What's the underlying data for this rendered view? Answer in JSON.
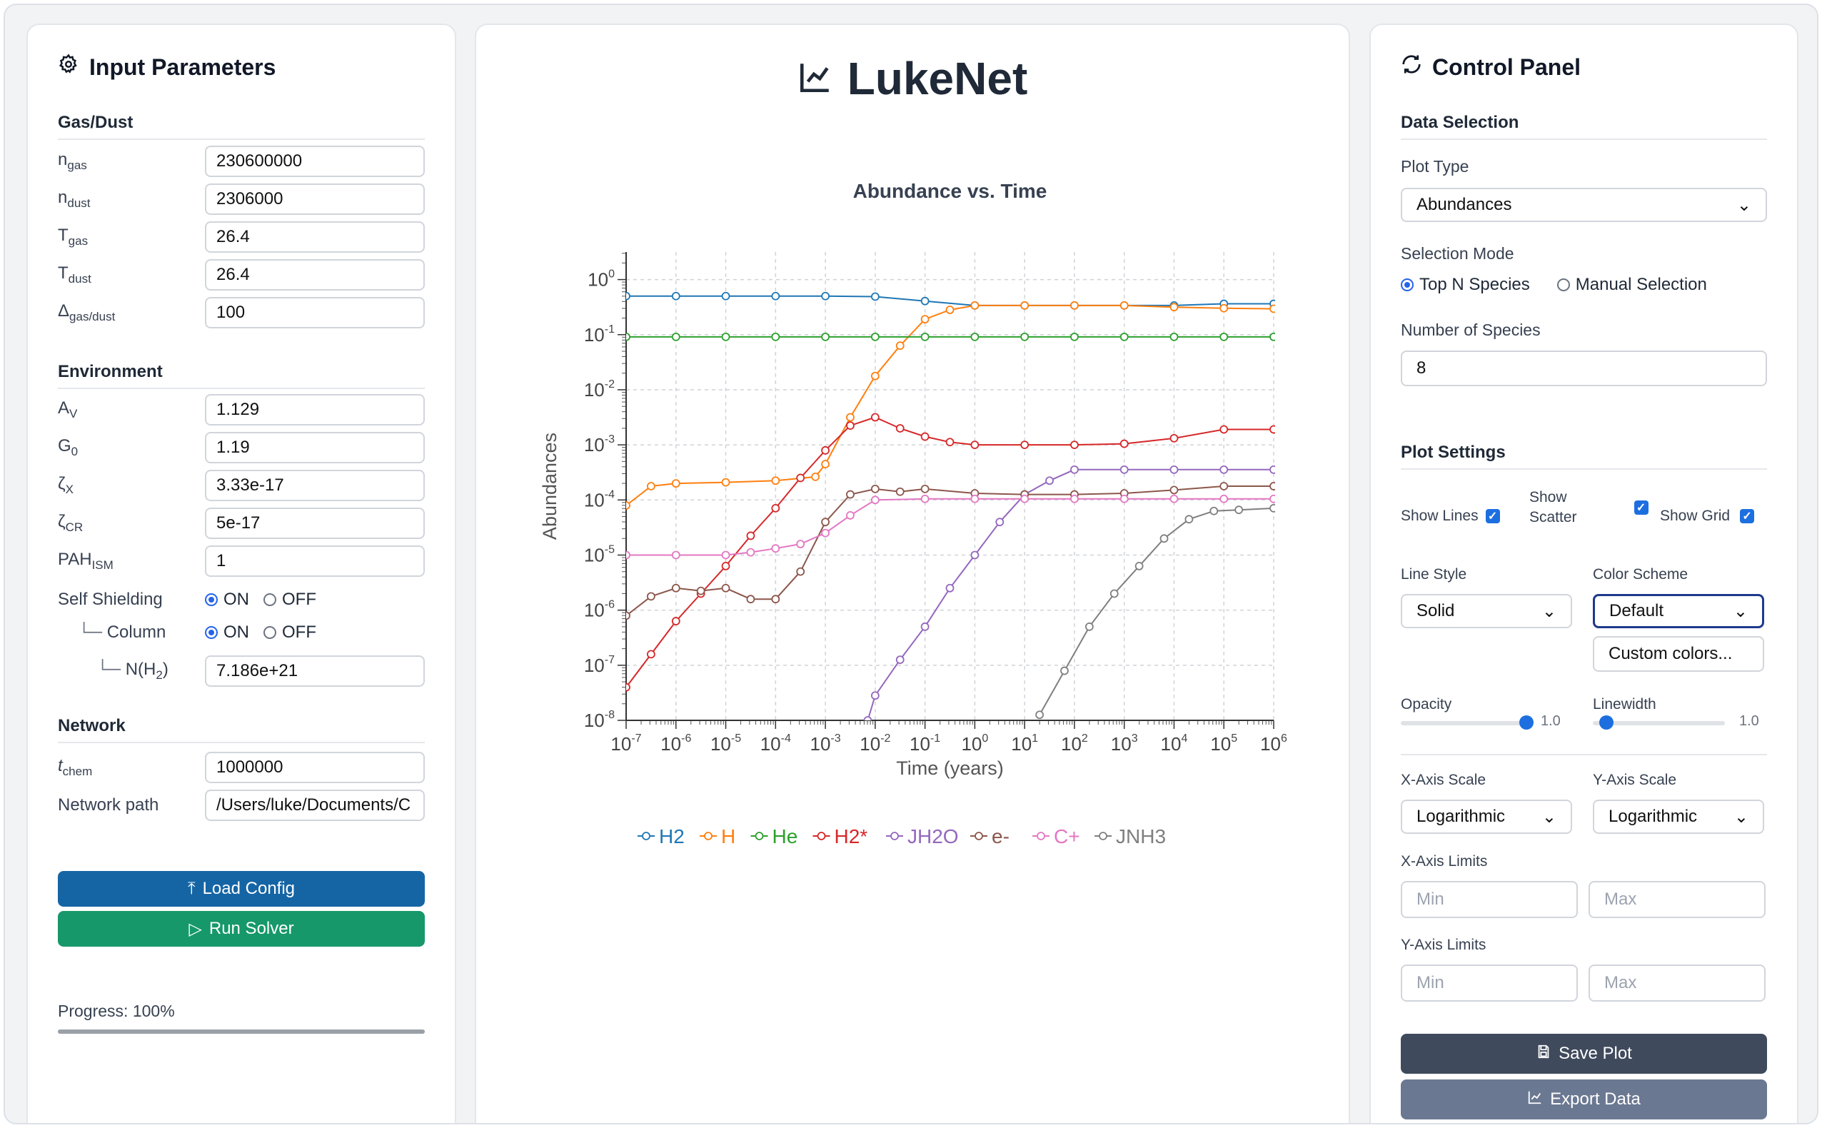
{
  "left": {
    "title": "Input Parameters",
    "gas_dust": {
      "heading": "Gas/Dust",
      "fields": [
        {
          "label": "n",
          "sub": "gas",
          "value": "230600000"
        },
        {
          "label": "n",
          "sub": "dust",
          "value": "2306000"
        },
        {
          "label": "T",
          "sub": "gas",
          "value": "26.4"
        },
        {
          "label": "T",
          "sub": "dust",
          "value": "26.4"
        },
        {
          "label": "Δ",
          "sub": "gas/dust",
          "value": "100"
        }
      ]
    },
    "environment": {
      "heading": "Environment",
      "fields": [
        {
          "label": "A",
          "sub": "V",
          "value": "1.129"
        },
        {
          "label": "G",
          "sub": "0",
          "value": "1.19"
        },
        {
          "label": "ζ",
          "sub": "X",
          "value": "3.33e-17"
        },
        {
          "label": "ζ",
          "sub": "CR",
          "value": "5e-17"
        },
        {
          "label": "PAH",
          "sub": "ISM",
          "value": "1"
        }
      ],
      "self_shielding": {
        "label": "Self Shielding",
        "on": "ON",
        "off": "OFF",
        "selected": "ON"
      },
      "column": {
        "label": "Column",
        "on": "ON",
        "off": "OFF",
        "selected": "ON"
      },
      "nh2": {
        "label": "N(H",
        "sub": "2",
        "label_end": ")",
        "value": "7.186e+21"
      }
    },
    "network": {
      "heading": "Network",
      "tchem": {
        "label": "t",
        "sub": "chem",
        "value": "1000000"
      },
      "path": {
        "label": "Network path",
        "value": "/Users/luke/Documents/C"
      }
    },
    "load_label": "Load Config",
    "run_label": "Run Solver",
    "progress_text": "Progress: 100%",
    "progress": 1.0
  },
  "center": {
    "title": "LukeNet"
  },
  "chart_data": {
    "type": "line",
    "title": "Abundance vs. Time",
    "xlabel": "Time (years)",
    "ylabel": "Abundances",
    "xscale": "log",
    "yscale": "log",
    "xlim": [
      1e-07,
      1000000.0
    ],
    "ylim": [
      1e-08,
      2
    ],
    "grid": true,
    "legend_position": "bottom",
    "x_tick_labels": [
      "10-7",
      "10-6",
      "10-5",
      "10-4",
      "10-3",
      "10-2",
      "10-1",
      "100",
      "101",
      "102",
      "103",
      "104",
      "105",
      "106"
    ],
    "y_tick_labels": [
      "10-8",
      "10-7",
      "10-6",
      "10-5",
      "10-4",
      "10-3",
      "10-2",
      "10-1",
      "100"
    ],
    "series": [
      {
        "name": "H2",
        "color": "#1f77b4",
        "points": [
          [
            -7,
            -0.3
          ],
          [
            -6,
            -0.3
          ],
          [
            -5,
            -0.3
          ],
          [
            -4,
            -0.3
          ],
          [
            -3,
            -0.3
          ],
          [
            -2,
            -0.31
          ],
          [
            -1,
            -0.39
          ],
          [
            0,
            -0.47
          ],
          [
            1,
            -0.47
          ],
          [
            2,
            -0.47
          ],
          [
            3,
            -0.47
          ],
          [
            4,
            -0.47
          ],
          [
            5,
            -0.44
          ],
          [
            6,
            -0.44
          ]
        ]
      },
      {
        "name": "H",
        "color": "#ff7f0e",
        "points": [
          [
            -7,
            -4.1
          ],
          [
            -6.5,
            -3.75
          ],
          [
            -6,
            -3.7
          ],
          [
            -5,
            -3.68
          ],
          [
            -4,
            -3.65
          ],
          [
            -3.2,
            -3.58
          ],
          [
            -3,
            -3.35
          ],
          [
            -2.5,
            -2.5
          ],
          [
            -2,
            -1.75
          ],
          [
            -1.5,
            -1.2
          ],
          [
            -1,
            -0.72
          ],
          [
            -0.5,
            -0.55
          ],
          [
            0,
            -0.47
          ],
          [
            1,
            -0.47
          ],
          [
            2,
            -0.47
          ],
          [
            3,
            -0.47
          ],
          [
            4,
            -0.5
          ],
          [
            5,
            -0.52
          ],
          [
            6,
            -0.53
          ]
        ]
      },
      {
        "name": "He",
        "color": "#2ca02c",
        "points": [
          [
            -7,
            -1.04
          ],
          [
            -6,
            -1.04
          ],
          [
            -5,
            -1.04
          ],
          [
            -4,
            -1.04
          ],
          [
            -3,
            -1.04
          ],
          [
            -2,
            -1.04
          ],
          [
            -1,
            -1.04
          ],
          [
            0,
            -1.04
          ],
          [
            1,
            -1.04
          ],
          [
            2,
            -1.04
          ],
          [
            3,
            -1.04
          ],
          [
            4,
            -1.04
          ],
          [
            5,
            -1.04
          ],
          [
            6,
            -1.04
          ]
        ]
      },
      {
        "name": "H2*",
        "color": "#d62728",
        "points": [
          [
            -7,
            -7.4
          ],
          [
            -6.5,
            -6.8
          ],
          [
            -6,
            -6.2
          ],
          [
            -5.5,
            -5.7
          ],
          [
            -5,
            -5.2
          ],
          [
            -4.5,
            -4.65
          ],
          [
            -4,
            -4.15
          ],
          [
            -3.5,
            -3.6
          ],
          [
            -3,
            -3.1
          ],
          [
            -2.5,
            -2.65
          ],
          [
            -2,
            -2.5
          ],
          [
            -1.5,
            -2.7
          ],
          [
            -1,
            -2.85
          ],
          [
            -0.5,
            -2.95
          ],
          [
            0,
            -3.0
          ],
          [
            1,
            -3.0
          ],
          [
            2,
            -3.0
          ],
          [
            3,
            -2.98
          ],
          [
            4,
            -2.88
          ],
          [
            5,
            -2.72
          ],
          [
            6,
            -2.72
          ]
        ]
      },
      {
        "name": "JH2O",
        "color": "#9467bd",
        "points": [
          [
            -2.15,
            -8
          ],
          [
            -2,
            -7.55
          ],
          [
            -1.5,
            -6.9
          ],
          [
            -1,
            -6.3
          ],
          [
            -0.5,
            -5.6
          ],
          [
            0,
            -5.0
          ],
          [
            0.5,
            -4.4
          ],
          [
            1,
            -3.9
          ],
          [
            1.5,
            -3.65
          ],
          [
            2,
            -3.45
          ],
          [
            3,
            -3.45
          ],
          [
            4,
            -3.45
          ],
          [
            5,
            -3.45
          ],
          [
            6,
            -3.45
          ]
        ]
      },
      {
        "name": "e-",
        "color": "#8c564b",
        "points": [
          [
            -7,
            -6.1
          ],
          [
            -6.5,
            -5.75
          ],
          [
            -6,
            -5.6
          ],
          [
            -5.5,
            -5.65
          ],
          [
            -5,
            -5.6
          ],
          [
            -4.5,
            -5.8
          ],
          [
            -4,
            -5.8
          ],
          [
            -3.5,
            -5.3
          ],
          [
            -3,
            -4.4
          ],
          [
            -2.5,
            -3.9
          ],
          [
            -2,
            -3.8
          ],
          [
            -1.5,
            -3.85
          ],
          [
            -1,
            -3.8
          ],
          [
            0,
            -3.88
          ],
          [
            1,
            -3.9
          ],
          [
            2,
            -3.9
          ],
          [
            3,
            -3.88
          ],
          [
            4,
            -3.82
          ],
          [
            5,
            -3.75
          ],
          [
            6,
            -3.75
          ]
        ]
      },
      {
        "name": "C+",
        "color": "#e377c2",
        "points": [
          [
            -7,
            -5.0
          ],
          [
            -6,
            -5.0
          ],
          [
            -5,
            -5.0
          ],
          [
            -4.5,
            -4.95
          ],
          [
            -4,
            -4.88
          ],
          [
            -3.5,
            -4.8
          ],
          [
            -3,
            -4.6
          ],
          [
            -2.5,
            -4.28
          ],
          [
            -2,
            -4.0
          ],
          [
            -1,
            -3.98
          ],
          [
            0,
            -3.98
          ],
          [
            1,
            -3.98
          ],
          [
            2,
            -3.98
          ],
          [
            3,
            -3.98
          ],
          [
            4,
            -3.98
          ],
          [
            5,
            -3.98
          ],
          [
            6,
            -3.98
          ]
        ]
      },
      {
        "name": "JNH3",
        "color": "#7f7f7f",
        "points": [
          [
            1.3,
            -7.9
          ],
          [
            1.8,
            -7.1
          ],
          [
            2.3,
            -6.3
          ],
          [
            2.8,
            -5.7
          ],
          [
            3.3,
            -5.2
          ],
          [
            3.8,
            -4.7
          ],
          [
            4.3,
            -4.35
          ],
          [
            4.8,
            -4.2
          ],
          [
            5.3,
            -4.18
          ],
          [
            6,
            -4.15
          ]
        ]
      }
    ]
  },
  "right": {
    "title": "Control Panel",
    "data_selection": {
      "heading": "Data Selection",
      "plot_type_label": "Plot Type",
      "plot_type_value": "Abundances",
      "selection_mode_label": "Selection Mode",
      "mode_top": "Top N Species",
      "mode_manual": "Manual Selection",
      "selected_mode": "Top N Species",
      "num_species_label": "Number of Species",
      "num_species_value": "8"
    },
    "plot_settings": {
      "heading": "Plot Settings",
      "show_lines": "Show Lines",
      "show_scatter_1": "Show",
      "show_scatter_2": "Scatter",
      "show_grid": "Show Grid",
      "line_style_label": "Line Style",
      "line_style_value": "Solid",
      "color_scheme_label": "Color Scheme",
      "color_scheme_value": "Default",
      "custom_colors": "Custom colors...",
      "opacity_label": "Opacity",
      "opacity_value": "1.0",
      "linewidth_label": "Linewidth",
      "linewidth_value": "1.0",
      "opacity_fraction": 1.0,
      "linewidth_fraction": 0.1,
      "xscale_label": "X-Axis Scale",
      "xscale_value": "Logarithmic",
      "yscale_label": "Y-Axis Scale",
      "yscale_value": "Logarithmic",
      "xlimits_label": "X-Axis Limits",
      "ylimits_label": "Y-Axis Limits",
      "min_placeholder": "Min",
      "max_placeholder": "Max"
    },
    "save_label": "Save Plot",
    "export_label": "Export Data"
  }
}
